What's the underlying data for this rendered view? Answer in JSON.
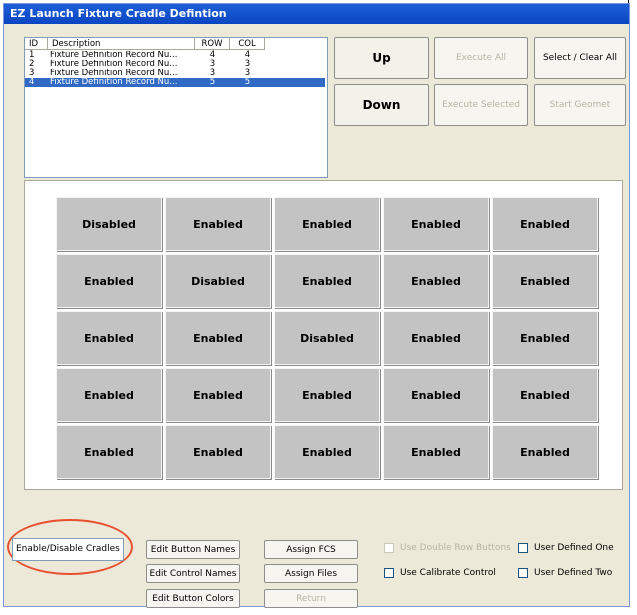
{
  "window": {
    "title": "EZ Launch Fixture Cradle Defintion"
  },
  "list": {
    "headers": {
      "id": "ID",
      "description": "Description",
      "row": "ROW",
      "col": "COL"
    },
    "rows": [
      {
        "id": "1",
        "description": "Fixture Definition Record Nu...",
        "row": "4",
        "col": "4"
      },
      {
        "id": "2",
        "description": "Fixture Definition Record Nu...",
        "row": "3",
        "col": "3"
      },
      {
        "id": "3",
        "description": "Fixture Definition Record Nu...",
        "row": "3",
        "col": "3"
      },
      {
        "id": "4",
        "description": "Fixture Definition Record Nu...",
        "row": "5",
        "col": "5"
      }
    ],
    "selected_index": 3
  },
  "buttons": {
    "up": "Up",
    "down": "Down",
    "execute_all": "Execute All",
    "execute_selected": "Execute Selected",
    "select_clear_all": "Select / Clear All",
    "start_geomet": "Start Geomet"
  },
  "grid": [
    [
      "Disabled",
      "Enabled",
      "Enabled",
      "Enabled",
      "Enabled"
    ],
    [
      "Enabled",
      "Disabled",
      "Enabled",
      "Enabled",
      "Enabled"
    ],
    [
      "Enabled",
      "Enabled",
      "Disabled",
      "Enabled",
      "Enabled"
    ],
    [
      "Enabled",
      "Enabled",
      "Enabled",
      "Enabled",
      "Enabled"
    ],
    [
      "Enabled",
      "Enabled",
      "Enabled",
      "Enabled",
      "Enabled"
    ]
  ],
  "bottom": {
    "mode_field": "Enable/Disable Cradles",
    "edit_button_names": "Edit Button Names",
    "edit_control_names": "Edit Control Names",
    "edit_button_colors": "Edit Button Colors",
    "assign_fcs": "Assign FCS",
    "assign_files": "Assign Files",
    "return": "Return",
    "use_double_row_buttons": "Use Double Row Buttons",
    "use_calibrate_control": "Use Calibrate Control",
    "user_defined_one": "User Defined One",
    "user_defined_two": "User Defined Two"
  },
  "colors": {
    "title_bar": "#0b45c2",
    "selection": "#316ac5",
    "annotation": "#e8502f"
  }
}
